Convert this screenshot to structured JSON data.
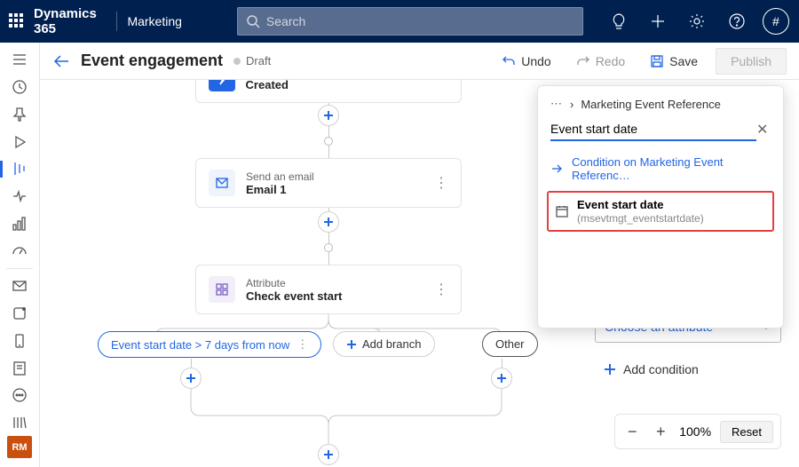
{
  "topnav": {
    "brand": "Dynamics 365",
    "area": "Marketing",
    "search_placeholder": "Search",
    "avatar_symbol": "#"
  },
  "leftrail": {
    "avatar": "RM"
  },
  "toolbar": {
    "title": "Event engagement",
    "status": "Draft",
    "undo": "Undo",
    "redo": "Redo",
    "save": "Save",
    "publish": "Publish"
  },
  "cards": {
    "trigger": {
      "title": "Marketing Event Registration Created"
    },
    "email": {
      "kind": "Send an email",
      "name": "Email 1"
    },
    "attr": {
      "kind": "Attribute",
      "name": "Check event start"
    }
  },
  "branches": {
    "condition": "Event start date > 7 days from now",
    "add": "Add branch",
    "other": "Other"
  },
  "zoom": {
    "value": "100%",
    "reset": "Reset"
  },
  "popover": {
    "breadcrumb": "Marketing Event Reference",
    "search_value": "Event start date",
    "link": "Condition on Marketing Event Referenc…",
    "match_label": "Event start date",
    "match_schema": "(msevtmgt_eventstartdate)"
  },
  "panel": {
    "attr_placeholder": "Choose an attribute",
    "add_condition": "Add condition"
  }
}
